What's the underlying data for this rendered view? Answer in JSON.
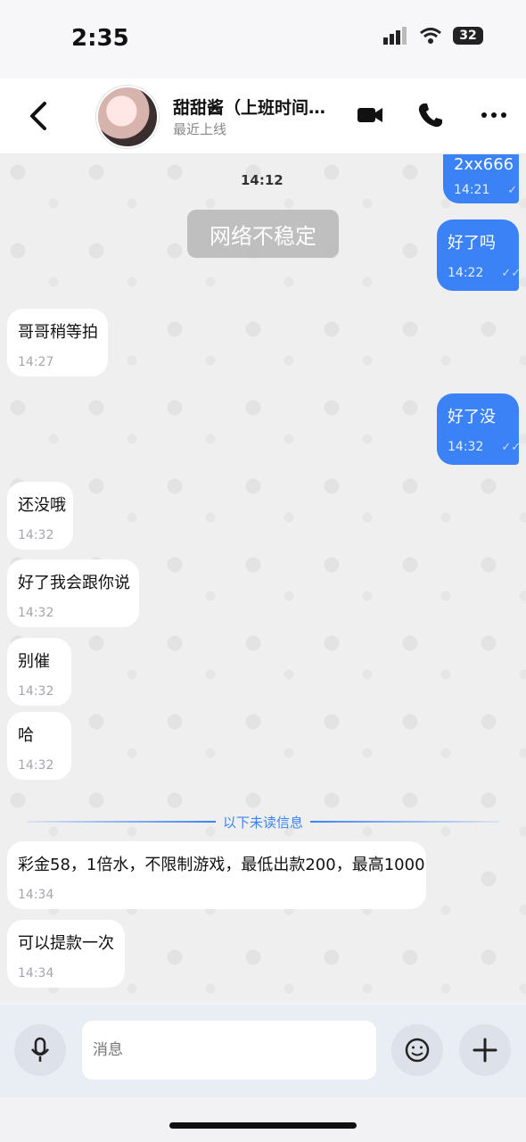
{
  "status": {
    "time": "2:35",
    "battery": "32"
  },
  "header": {
    "name": "甜甜酱（上班时间…",
    "last_seen": "最近上线"
  },
  "chat": {
    "date": "14:12",
    "notice": "网络不稳定",
    "partial_top_text": "2xx666",
    "unread_label": "以下未读信息",
    "messages": [
      {
        "dir": "out",
        "text": "",
        "time": "14:21"
      },
      {
        "dir": "out",
        "text": "好了吗",
        "time": "14:22"
      },
      {
        "dir": "in",
        "text": "哥哥稍等拍",
        "time": "14:27"
      },
      {
        "dir": "out",
        "text": "好了没",
        "time": "14:32"
      },
      {
        "dir": "in",
        "text": "还没哦",
        "time": "14:32"
      },
      {
        "dir": "in",
        "text": "好了我会跟你说",
        "time": "14:32"
      },
      {
        "dir": "in",
        "text": "别催",
        "time": "14:32"
      },
      {
        "dir": "in",
        "text": "哈",
        "time": "14:32"
      },
      {
        "dir": "in",
        "text": "彩金58，1倍水，不限制游戏，最低出款200，最高1000",
        "time": "14:34"
      },
      {
        "dir": "in",
        "text": "可以提款一次",
        "time": "14:34"
      }
    ]
  },
  "composer": {
    "placeholder": "消息"
  }
}
